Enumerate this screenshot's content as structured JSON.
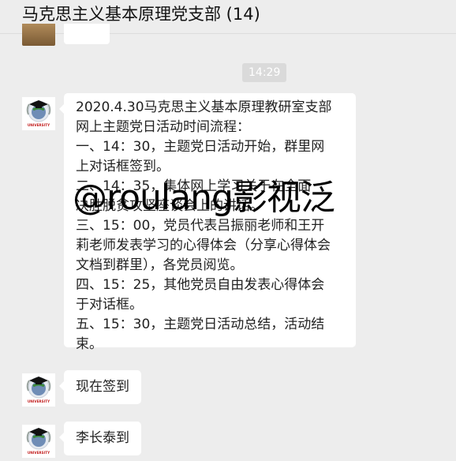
{
  "header": {
    "title": "马克思主义基本原理党支部 (14)"
  },
  "time_label": "14:29",
  "messages": [
    {
      "lines": [
        "2020.4.30马克思主义基本原理教研室支部",
        "网上主题党日活动时间流程：",
        "一、14：30，主题党日活动开始，群里网",
        "上对话框签到。",
        "二、14：35，集体网上学习关于在全面",
        "决胜脱贫攻坚座谈会上的讲话。",
        "三、15：00，党员代表吕振丽老师和王开",
        "莉老师发表学习的心得体会（分享心得体会",
        "文档到群里），各党员阅览。",
        "四、15：25，其他党员自由发表心得体会",
        "于对话框。",
        "五、15：30，主题党日活动总结，活动结",
        "束。"
      ]
    },
    {
      "text": "现在签到"
    },
    {
      "text": "李长泰到"
    }
  ],
  "avatar_text": "UNIVERSITY",
  "watermark": "@roulang影视泛"
}
